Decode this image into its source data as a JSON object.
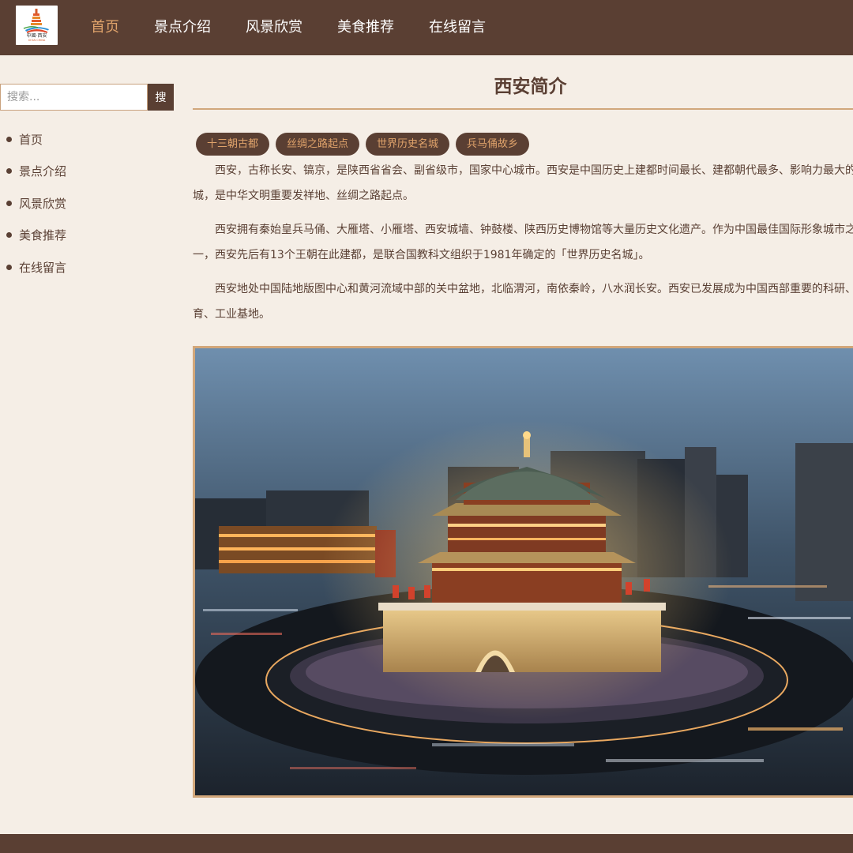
{
  "header": {
    "logo": {
      "text": "中國·西安",
      "subtext": "XI'AN CHINA",
      "icon": "pagoda-logo-icon"
    },
    "nav": [
      {
        "label": "首页",
        "active": true
      },
      {
        "label": "景点介绍",
        "active": false
      },
      {
        "label": "风景欣赏",
        "active": false
      },
      {
        "label": "美食推荐",
        "active": false
      },
      {
        "label": "在线留言",
        "active": false
      }
    ]
  },
  "sidebar": {
    "search": {
      "placeholder": "搜索...",
      "value": "",
      "button_label": "搜"
    },
    "menu": [
      {
        "label": "首页"
      },
      {
        "label": "景点介绍"
      },
      {
        "label": "风景欣赏"
      },
      {
        "label": "美食推荐"
      },
      {
        "label": "在线留言"
      }
    ]
  },
  "main": {
    "title": "西安简介",
    "tags": [
      "十三朝古都",
      "丝绸之路起点",
      "世界历史名城",
      "兵马俑故乡"
    ],
    "paragraphs": [
      "西安，古称长安、镐京，是陕西省省会、副省级市，国家中心城市。西安是中国历史上建都时间最长、建都朝代最多、影响力最大的都城，是中华文明重要发祥地、丝绸之路起点。",
      "西安拥有秦始皇兵马俑、大雁塔、小雁塔、西安城墙、钟鼓楼、陕西历史博物馆等大量历史文化遗产。作为中国最佳国际形象城市之一，西安先后有13个王朝在此建都，是联合国教科文组织于1981年确定的「世界历史名城」。",
      "西安地处中国陆地版图中心和黄河流域中部的关中盆地，北临渭河，南依秦岭，八水润长安。西安已发展成为中国西部重要的科研、教育、工业基地。"
    ],
    "photo": {
      "icon": "bell-tower-photo"
    }
  },
  "colors": {
    "header_bg": "#5a3f33",
    "page_bg": "#f5eee6",
    "accent": "#e0a36b",
    "rule": "#d1a77c",
    "text": "#5a4034"
  }
}
